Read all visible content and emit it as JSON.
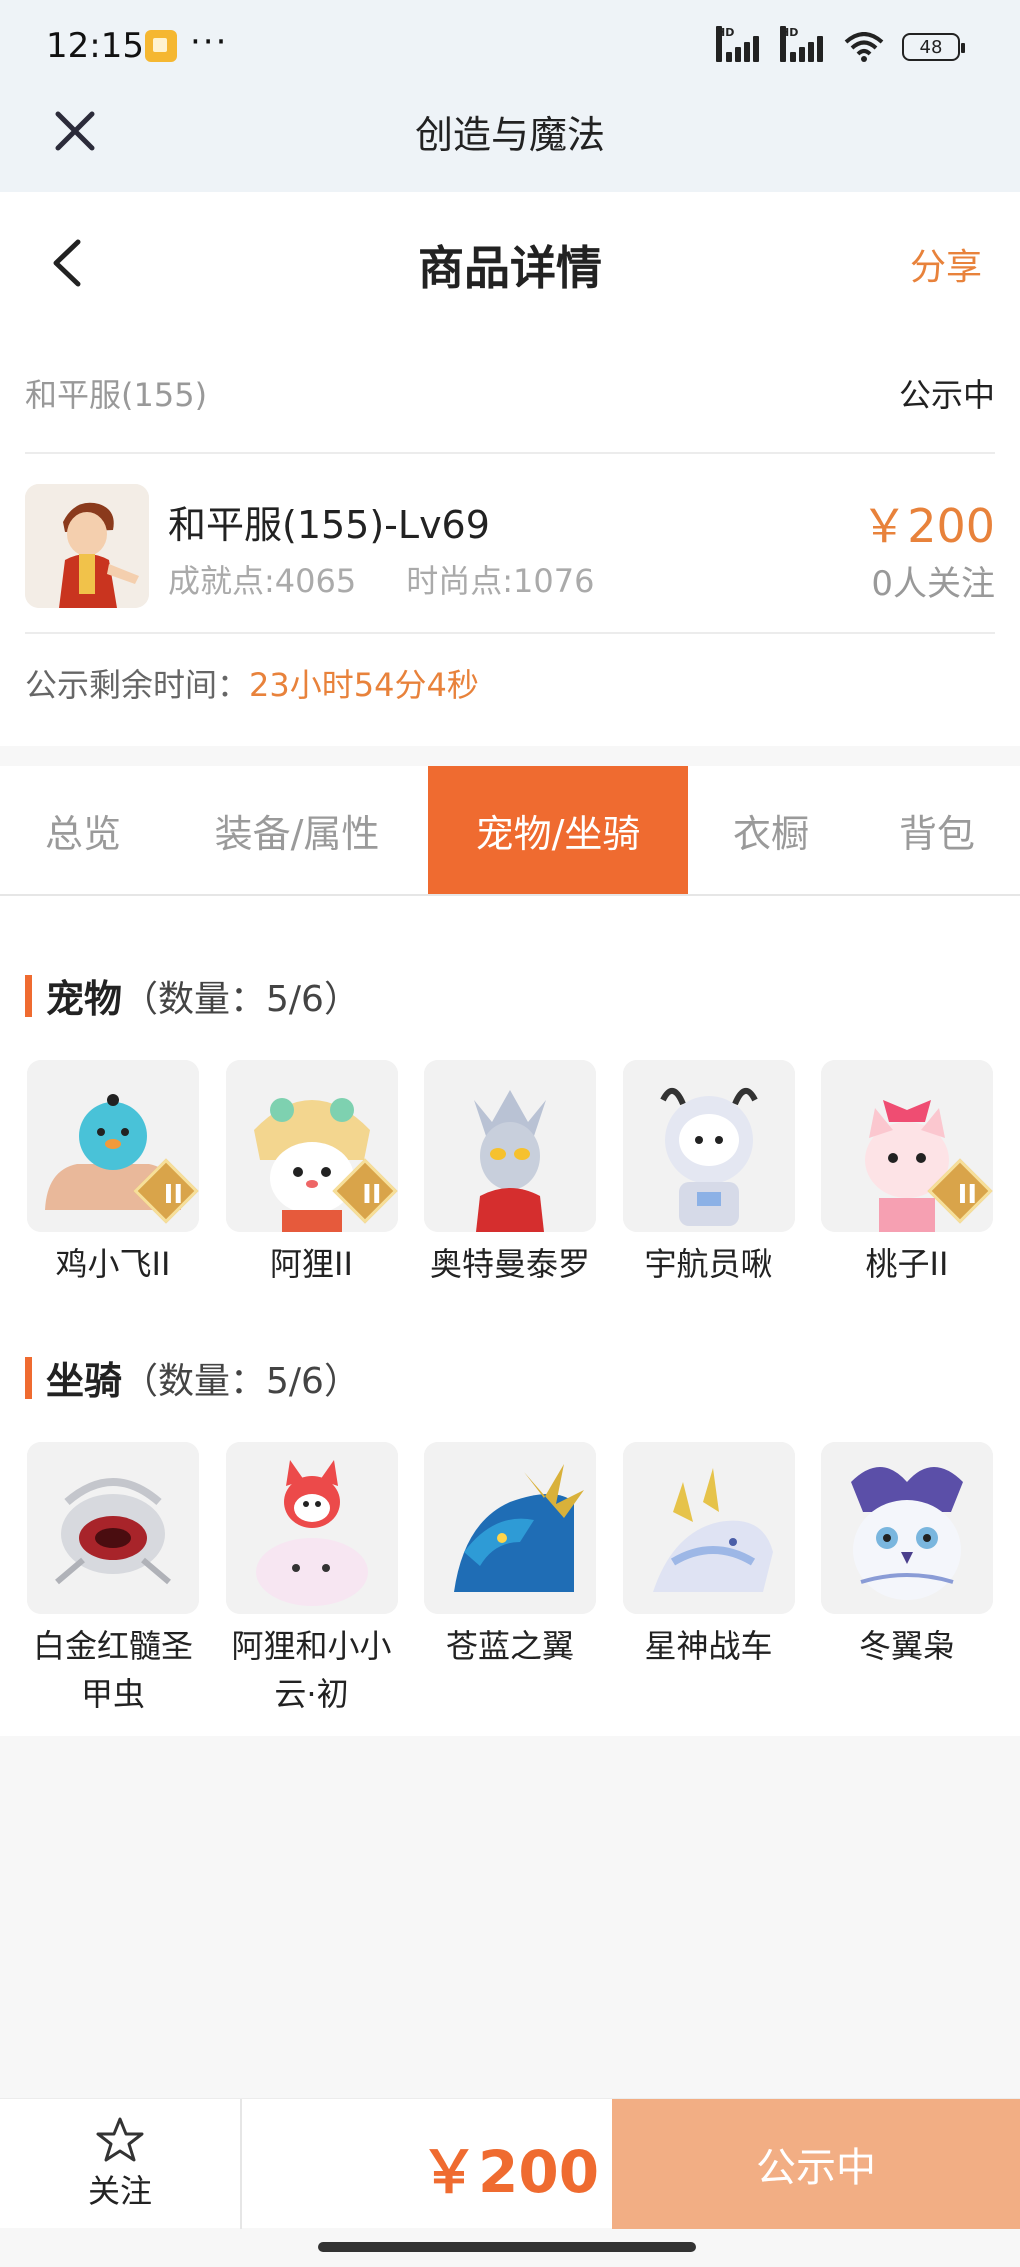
{
  "status_bar": {
    "time": "12:15",
    "dots": "···",
    "battery": "48",
    "hd_label": "HD"
  },
  "mini_header": {
    "title": "创造与魔法"
  },
  "page_header": {
    "title": "商品详情",
    "share": "分享"
  },
  "server": {
    "name": "和平服(155)",
    "status": "公示中"
  },
  "character": {
    "title": "和平服(155)-Lv69",
    "achievement": "成就点:4065",
    "fashion": "时尚点:1076",
    "price": "￥200",
    "followers": "0人关注"
  },
  "countdown": {
    "label": "公示剩余时间：",
    "value": "23小时54分4秒"
  },
  "tabs": [
    {
      "label": "总览"
    },
    {
      "label": "装备/属性"
    },
    {
      "label": "宠物/坐骑",
      "active": true
    },
    {
      "label": "衣橱"
    },
    {
      "label": "背包"
    }
  ],
  "pets": {
    "title": "宠物",
    "count": "（数量：5/6）",
    "items": [
      {
        "name": "鸡小飞II",
        "badge": "II",
        "icon": "blue-chick-pet"
      },
      {
        "name": "阿狸II",
        "badge": "II",
        "icon": "fox-pet"
      },
      {
        "name": "奥特曼泰罗",
        "icon": "ultraman-pet"
      },
      {
        "name": "宇航员啾",
        "icon": "astronaut-pet"
      },
      {
        "name": "桃子II",
        "badge": "II",
        "icon": "pink-cat-pet"
      }
    ]
  },
  "mounts": {
    "title": "坐骑",
    "count": "（数量：5/6）",
    "items": [
      {
        "name": "白金红髓圣甲虫",
        "icon": "beetle-mount"
      },
      {
        "name": "阿狸和小小云·初",
        "icon": "fox-cloud-mount"
      },
      {
        "name": "苍蓝之翼",
        "icon": "blue-dragon-mount"
      },
      {
        "name": "星神战车",
        "icon": "white-dragon-mount"
      },
      {
        "name": "冬翼枭",
        "icon": "owl-mount"
      }
    ]
  },
  "bottom_bar": {
    "follow": "关注",
    "price": "￥200",
    "action": "公示中"
  },
  "colors": {
    "accent": "#ef6b30",
    "price": "#e8823b",
    "buy_button": "#f2ae84"
  }
}
